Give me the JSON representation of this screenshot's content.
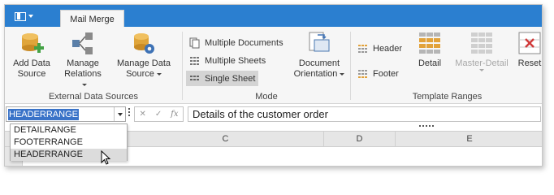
{
  "tabs": [
    {
      "label": "Mail Merge",
      "active": true
    }
  ],
  "ribbon": {
    "external_data": {
      "label": "External Data Sources",
      "buttons": [
        {
          "line1": "Add Data",
          "line2": "Source",
          "icon": "database-add-icon"
        },
        {
          "line1": "Manage",
          "line2": "Relations",
          "icon": "relations-icon",
          "dropdown": true
        },
        {
          "line1": "Manage Data",
          "line2": "Source",
          "icon": "database-gear-icon",
          "dropdown": true
        }
      ]
    },
    "mode": {
      "label": "Mode",
      "multiple_documents": "Multiple Documents",
      "multiple_sheets": "Multiple Sheets",
      "single_sheet": "Single Sheet",
      "document_orientation_line1": "Document",
      "document_orientation_line2": "Orientation"
    },
    "template_ranges": {
      "label": "Template Ranges",
      "header": "Header",
      "footer": "Footer",
      "detail": "Detail",
      "master_detail": "Master-Detail",
      "reset": "Reset"
    }
  },
  "formula_bar": {
    "name_box_value": "HEADERRANGE",
    "formula_text": "Details of the customer order"
  },
  "name_dropdown": {
    "items": [
      "DETAILRANGE",
      "FOOTERRANGE",
      "HEADERRANGE"
    ],
    "hovered_index": 2
  },
  "columns": [
    "C",
    "D",
    "E"
  ],
  "colors": {
    "accent": "#2b7fd0",
    "selection": "#3a73c8",
    "ribbon_bg": "#f6f6f6"
  }
}
